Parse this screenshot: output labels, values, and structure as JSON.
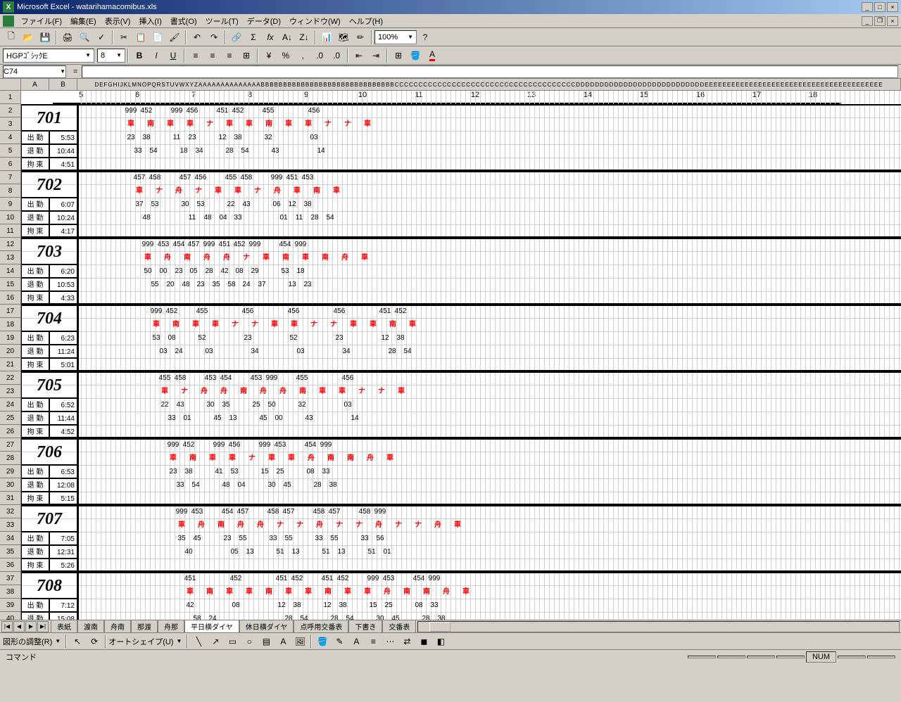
{
  "app": {
    "title": "Microsoft Excel - watarihamacomibus.xls"
  },
  "menu": {
    "file": "ファイル(F)",
    "edit": "編集(E)",
    "view": "表示(V)",
    "insert": "挿入(I)",
    "format": "書式(O)",
    "tools": "ツール(T)",
    "data": "データ(D)",
    "window": "ウィンドウ(W)",
    "help": "ヘルプ(H)"
  },
  "format_toolbar": {
    "font_name": "HGPｺﾞｼｯｸE",
    "font_size": "8"
  },
  "cellref": {
    "name": "C74",
    "fx": "="
  },
  "zoom": "100%",
  "col_headers": [
    "A",
    "B"
  ],
  "col_top_small": "DEFGHIJKLMNOPQRSTUVWXYZAAAAAAAAAAAAAABBBBBBBBBBBBBBBBBBBBBBBBBBBBBBCCCCCCCCCCCCCCCCCCCCCCCCCCCCCCCCCCCCCCDDDDDDDDDDDDDDDDDDDDDDDDDDDEEEEEEEEEEEEEEEEEEEEEEEEEEEEEEEEEEEEEEEE",
  "row_headers": [
    "1",
    "2",
    "3",
    "4",
    "5",
    "6",
    "7",
    "8",
    "9",
    "10",
    "11",
    "12",
    "13",
    "14",
    "15",
    "16",
    "17",
    "18",
    "19",
    "20",
    "21",
    "22",
    "23",
    "24",
    "25",
    "26",
    "27",
    "28",
    "29",
    "30",
    "31",
    "32",
    "33",
    "34",
    "35",
    "36",
    "37",
    "38",
    "39",
    "40"
  ],
  "hours": [
    "5",
    "6",
    "7",
    "8",
    "9",
    "10",
    "11",
    "12",
    "13",
    "14",
    "15",
    "16",
    "17",
    "18"
  ],
  "labels": {
    "shukkin": "出 勤",
    "taikin": "退 勤",
    "kosoku": "拘 束"
  },
  "blocks": [
    {
      "num": "701",
      "shukkin": "5:53",
      "taikin": "10:44",
      "kosoku": "4:51",
      "r1": [
        [
          "999",
          "452"
        ],
        [
          "999",
          "456"
        ],
        [
          "451",
          "452"
        ],
        [
          "455"
        ],
        [
          "456"
        ]
      ],
      "r2_red": [
        "車",
        "南",
        "車",
        "車",
        "ナ",
        "車",
        "車",
        "南",
        "車",
        "車",
        "ナ",
        "ナ",
        "車"
      ],
      "r3": [
        [
          "23",
          "38"
        ],
        [
          "11",
          "23"
        ],
        [
          "12",
          "38"
        ],
        [
          "32"
        ],
        [
          "03"
        ]
      ],
      "r4": [
        [
          "33",
          "54"
        ],
        [
          "18",
          "34"
        ],
        [
          "28",
          "54"
        ],
        [
          "43"
        ],
        [
          "14"
        ]
      ]
    },
    {
      "num": "702",
      "shukkin": "6:07",
      "taikin": "10:24",
      "kosoku": "4:17",
      "r1": [
        [
          "457",
          "458"
        ],
        [
          "457",
          "456"
        ],
        [
          "455",
          "458"
        ],
        [
          "999",
          "451",
          "453"
        ]
      ],
      "r2_red": [
        "車",
        "ナ",
        "舟",
        "ナ",
        "車",
        "車",
        "ナ",
        "舟",
        "車",
        "南",
        "車"
      ],
      "r3": [
        [
          "37",
          "53"
        ],
        [
          "30",
          "53"
        ],
        [
          "22",
          "43"
        ],
        [
          "06",
          "12",
          "38"
        ]
      ],
      "r4": [
        [
          "48"
        ],
        [
          "11",
          "48",
          "04"
        ],
        [
          "33"
        ],
        [
          "01",
          "11",
          "28",
          "54"
        ]
      ]
    },
    {
      "num": "703",
      "shukkin": "6:20",
      "taikin": "10:53",
      "kosoku": "4:33",
      "r1": [
        [
          "999",
          "453",
          "454"
        ],
        [
          "457",
          "999",
          "451"
        ],
        [
          "452",
          "999"
        ],
        [
          "454",
          "999"
        ]
      ],
      "r2_red": [
        "車",
        "舟",
        "南",
        "舟",
        "舟",
        "ナ",
        "車",
        "南",
        "車",
        "南",
        "舟",
        "車"
      ],
      "r3": [
        [
          "50",
          "00",
          "23"
        ],
        [
          "05",
          "28",
          "42"
        ],
        [
          "08",
          "29"
        ],
        [
          "53",
          "18"
        ]
      ],
      "r4": [
        [
          "55",
          "20",
          "48"
        ],
        [
          "23",
          "35",
          "58"
        ],
        [
          "24",
          "37"
        ],
        [
          "13",
          "23"
        ]
      ]
    },
    {
      "num": "704",
      "shukkin": "6:23",
      "taikin": "11:24",
      "kosoku": "5:01",
      "r1": [
        [
          "999",
          "452"
        ],
        [
          "455"
        ],
        [
          "456"
        ],
        [
          "456"
        ],
        [
          "456"
        ],
        [
          "451",
          "452"
        ]
      ],
      "r2_red": [
        "車",
        "南",
        "車",
        "車",
        "ナ",
        "ナ",
        "車",
        "車",
        "ナ",
        "ナ",
        "車",
        "車",
        "南",
        "車"
      ],
      "r3": [
        [
          "53",
          "08"
        ],
        [
          "52"
        ],
        [
          "23"
        ],
        [
          "52"
        ],
        [
          "23"
        ],
        [
          "12",
          "38"
        ]
      ],
      "r4": [
        [
          "03",
          "24"
        ],
        [
          "03"
        ],
        [
          "34"
        ],
        [
          "03"
        ],
        [
          "34"
        ],
        [
          "28",
          "54"
        ]
      ]
    },
    {
      "num": "705",
      "shukkin": "6:52",
      "taikin": "11:44",
      "kosoku": "4:52",
      "r1": [
        [
          "455",
          "458"
        ],
        [
          "453",
          "454"
        ],
        [
          "453",
          "999"
        ],
        [
          "455"
        ],
        [
          "456"
        ]
      ],
      "r2_red": [
        "車",
        "ナ",
        "舟",
        "舟",
        "南",
        "舟",
        "舟",
        "南",
        "車",
        "車",
        "ナ",
        "ナ",
        "車"
      ],
      "r3": [
        [
          "22",
          "43"
        ],
        [
          "30",
          "35"
        ],
        [
          "25",
          "50"
        ],
        [
          "32"
        ],
        [
          "03"
        ]
      ],
      "r4": [
        [
          "33",
          "01"
        ],
        [
          "45",
          "13"
        ],
        [
          "45",
          "00"
        ],
        [
          "43"
        ],
        [
          "14"
        ]
      ]
    },
    {
      "num": "706",
      "shukkin": "6:53",
      "taikin": "12:08",
      "kosoku": "5:15",
      "r1": [
        [
          "999",
          "452"
        ],
        [
          "999",
          "456"
        ],
        [
          "999",
          "453"
        ],
        [
          "454",
          "999"
        ]
      ],
      "r2_red": [
        "車",
        "南",
        "車",
        "車",
        "ナ",
        "車",
        "車",
        "舟",
        "南",
        "南",
        "舟",
        "車"
      ],
      "r3": [
        [
          "23",
          "38"
        ],
        [
          "41",
          "53"
        ],
        [
          "15",
          "25"
        ],
        [
          "08",
          "33"
        ]
      ],
      "r4": [
        [
          "33",
          "54"
        ],
        [
          "48",
          "04"
        ],
        [
          "30",
          "45"
        ],
        [
          "28",
          "38"
        ]
      ]
    },
    {
      "num": "707",
      "shukkin": "7:05",
      "taikin": "12:31",
      "kosoku": "5:26",
      "r1": [
        [
          "999",
          "453"
        ],
        [
          "454",
          "457"
        ],
        [
          "458",
          "457"
        ],
        [
          "458",
          "457"
        ],
        [
          "458",
          "999"
        ]
      ],
      "r2_red": [
        "車",
        "舟",
        "南",
        "舟",
        "舟",
        "ナ",
        "ナ",
        "舟",
        "ナ",
        "ナ",
        "舟",
        "ナ",
        "ナ",
        "舟",
        "車"
      ],
      "r3": [
        [
          "35",
          "45"
        ],
        [
          "23",
          "55"
        ],
        [
          "33",
          "55"
        ],
        [
          "33",
          "55"
        ],
        [
          "33",
          "56"
        ]
      ],
      "r4": [
        [
          "40"
        ],
        [
          "05",
          "13"
        ],
        [
          "51",
          "13"
        ],
        [
          "51",
          "13"
        ],
        [
          "51",
          "01"
        ]
      ]
    },
    {
      "num": "708",
      "shukkin": "7:12",
      "taikin": "15:08",
      "kosoku": "",
      "r1": [
        [
          "451"
        ],
        [
          "452"
        ],
        [
          "451",
          "452"
        ],
        [
          "451",
          "452"
        ],
        [
          "999",
          "453"
        ],
        [
          "454",
          "999"
        ]
      ],
      "r2_red": [
        "車",
        "南",
        "車",
        "車",
        "南",
        "車",
        "車",
        "南",
        "車",
        "車",
        "舟",
        "南",
        "南",
        "舟",
        "車"
      ],
      "r3": [
        [
          "42"
        ],
        [
          "08"
        ],
        [
          "12",
          "38"
        ],
        [
          "12",
          "38"
        ],
        [
          "15",
          "25"
        ],
        [
          "08",
          "33"
        ]
      ],
      "r4": [
        [
          "58",
          "24"
        ],
        [
          ""
        ],
        [
          "28",
          "54"
        ],
        [
          "28",
          "54"
        ],
        [
          "30",
          "45"
        ],
        [
          "28",
          "38"
        ]
      ]
    }
  ],
  "tabs": {
    "t1": "表紙",
    "t2": "渡南",
    "t3": "舟南",
    "t4": "那渡",
    "t5": "舟那",
    "t6": "平日横ダイヤ",
    "t7": "休日横ダイヤ",
    "t8": "点呼用交番表",
    "t9": "下書き",
    "t10": "交番表"
  },
  "drawbar": {
    "label": "図形の調整(R)",
    "autoshape": "オートシェイプ(U)"
  },
  "status": {
    "cmd": "コマンド",
    "num": "NUM"
  }
}
